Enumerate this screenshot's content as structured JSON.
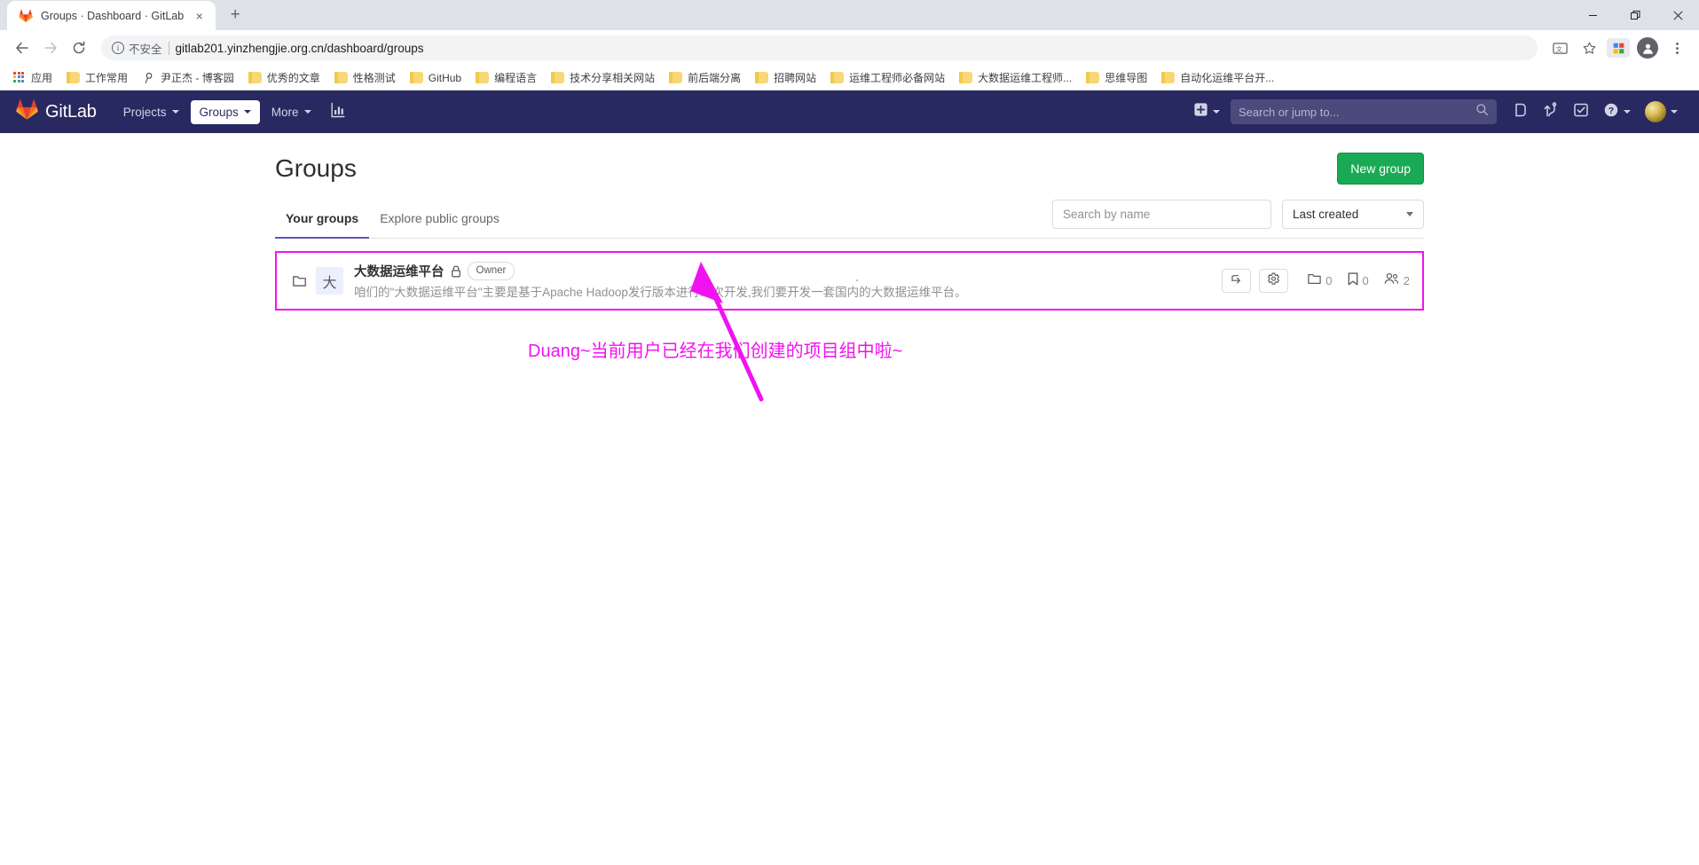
{
  "browser": {
    "tab": {
      "title": "Groups · Dashboard · GitLab",
      "favicon": "gitlab-fox-icon",
      "close": "×"
    },
    "new_tab_label": "+",
    "window_controls": {
      "minimize": "minimize-icon",
      "maximize": "maximize-icon",
      "close": "close-icon"
    },
    "toolbar": {
      "back": "back-arrow-icon",
      "forward": "forward-arrow-icon",
      "reload": "reload-icon",
      "security_label": "不安全",
      "url": "gitlab201.yinzhengjie.org.cn/dashboard/groups",
      "translate": "translate-icon",
      "bookmark_star": "star-icon",
      "extensions": "extension-icon",
      "profile": "profile-avatar-icon",
      "menu": "three-dot-menu-icon"
    },
    "bookmarks": [
      {
        "label": "应用",
        "icon": "apps-grid-icon"
      },
      {
        "label": "工作常用",
        "icon": "folder-icon"
      },
      {
        "label": "尹正杰 - 博客园",
        "icon": "site-icon"
      },
      {
        "label": "优秀的文章",
        "icon": "folder-icon"
      },
      {
        "label": "性格测试",
        "icon": "folder-icon"
      },
      {
        "label": "GitHub",
        "icon": "folder-icon"
      },
      {
        "label": "编程语言",
        "icon": "folder-icon"
      },
      {
        "label": "技术分享相关网站",
        "icon": "folder-icon"
      },
      {
        "label": "前后端分离",
        "icon": "folder-icon"
      },
      {
        "label": "招聘网站",
        "icon": "folder-icon"
      },
      {
        "label": "运维工程师必备网站",
        "icon": "folder-icon"
      },
      {
        "label": "大数据运维工程师...",
        "icon": "folder-icon"
      },
      {
        "label": "思维导图",
        "icon": "folder-icon"
      },
      {
        "label": "自动化运维平台开...",
        "icon": "folder-icon"
      }
    ]
  },
  "gitlab": {
    "brand": "GitLab",
    "nav_items": [
      {
        "label": "Projects",
        "active": false,
        "has_caret": true
      },
      {
        "label": "Groups",
        "active": true,
        "has_caret": true
      },
      {
        "label": "More",
        "active": false,
        "has_caret": true
      }
    ],
    "analytics_icon": "chart-bar-icon",
    "plus_icon": "plus-square-icon",
    "search_placeholder": "Search or jump to...",
    "search_icon": "search-icon",
    "right_icons": [
      {
        "name": "issues-icon"
      },
      {
        "name": "merge-requests-icon"
      },
      {
        "name": "todos-icon"
      },
      {
        "name": "help-icon"
      }
    ],
    "avatar": "user-avatar"
  },
  "page": {
    "title": "Groups",
    "new_group_button": "New group",
    "tabs": [
      {
        "label": "Your groups",
        "active": true
      },
      {
        "label": "Explore public groups",
        "active": false
      }
    ],
    "search_placeholder": "Search by name",
    "search_value": "",
    "sort_value": "Last created",
    "groups": [
      {
        "name": "大数据运维平台",
        "avatar_initial": "大",
        "visibility_icon": "lock-icon",
        "role_badge": "Owner",
        "description": "咱们的\"大数据运维平台\"主要是基于Apache Hadoop发行版本进行二次开发,我们要开发一套国内的大数据运维平台。",
        "actions": [
          {
            "name": "leave-group-button",
            "icon": "leave-arrow-icon"
          },
          {
            "name": "group-settings-button",
            "icon": "gear-icon"
          }
        ],
        "stats": [
          {
            "name": "subgroups-count",
            "icon": "folder-icon",
            "value": "0"
          },
          {
            "name": "projects-count",
            "icon": "bookmark-icon",
            "value": "0"
          },
          {
            "name": "members-count",
            "icon": "users-icon",
            "value": "2"
          }
        ]
      }
    ]
  },
  "annotation": {
    "text": "Duang~当前用户已经在我们创建的项目组中啦~",
    "color": "#f013f0"
  }
}
